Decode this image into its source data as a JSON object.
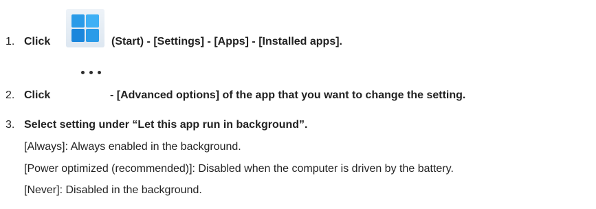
{
  "steps": [
    {
      "number": "1.",
      "before": "Click",
      "after": "(Start) - [Settings] - [Apps] - [Installed apps].",
      "icon": "windows-start-icon"
    },
    {
      "number": "2.",
      "before": "Click",
      "after": "- [Advanced options] of the app that you want to change the setting.",
      "icon": "more-options-ellipsis-icon"
    },
    {
      "number": "3.",
      "text": "Select setting under “Let this app run in background”.",
      "details": [
        "[Always]: Always enabled in the background.",
        "[Power optimized (recommended)]: Disabled when the computer is driven by the battery.",
        "[Never]: Disabled in the background."
      ]
    }
  ],
  "colors": {
    "text": "#222222",
    "start_tile_blue": "#1a8fe6",
    "start_tile_light": "#3fb0f5"
  }
}
